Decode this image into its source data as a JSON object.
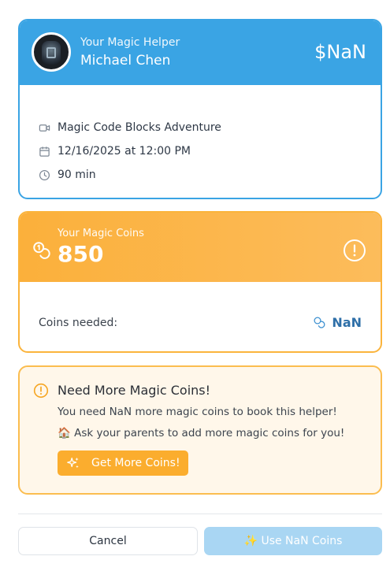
{
  "helper": {
    "subtitle": "Your Magic Helper",
    "name": "Michael Chen",
    "price": "$NaN",
    "details": {
      "session": "Magic Code Blocks Adventure",
      "datetime": "12/16/2025 at 12:00 PM",
      "duration": "90 min"
    }
  },
  "coins": {
    "label": "Your Magic Coins",
    "amount": "850",
    "needed_label": "Coins needed:",
    "needed_value": "NaN"
  },
  "need_more": {
    "title": "Need More Magic Coins!",
    "message": "You need NaN more magic coins to book this helper!",
    "hint": "🏠 Ask your parents to add more magic coins for you!",
    "button": "Get More Coins!"
  },
  "footer": {
    "cancel": "Cancel",
    "confirm": "✨ Use NaN Coins"
  },
  "colors": {
    "helper_accent": "#3aa4e4",
    "coins_accent": "#fbb03b",
    "confirm_disabled": "#a9d6f3"
  },
  "icons": {
    "session": "video-icon",
    "date": "calendar-icon",
    "duration": "clock-icon",
    "coins": "coins-icon",
    "alert": "alert-circle-icon",
    "sparkle": "sparkles-icon"
  }
}
